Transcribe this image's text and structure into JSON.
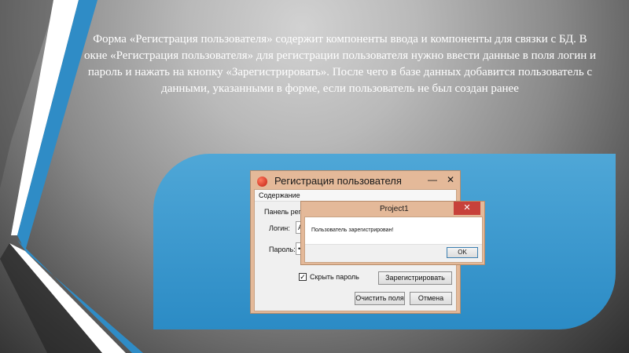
{
  "slide": {
    "caption": "Форма «Регистрация пользователя» содержит компоненты ввода и компоненты для связки с БД. В окне «Регистрация пользователя» для регистрации пользователя нужно ввести данные в поля логин и пароль и нажать на кнопку «Зарегистрировать». После чего в базе данных добавится пользователь с данными, указанными в форме, если пользователь не был создан ранее"
  },
  "reg_window": {
    "title": "Регистрация пользователя",
    "menu_item": "Содержание",
    "group_label": "Панель реги",
    "login_label": "Логин:",
    "password_label": "Пароль:",
    "login_value": "А",
    "password_value": "•",
    "show_password_label": "Скрыть пароль",
    "show_password_checked": "✓",
    "register_button": "Зарегистрировать",
    "clear_button": "Очистить поля",
    "cancel_button": "Отмена",
    "minimize_glyph": "—",
    "close_glyph": "✕"
  },
  "message_box": {
    "title": "Project1",
    "message": "Пользователь зарегистрирован!",
    "ok_button": "OK",
    "close_glyph": "✕"
  },
  "colors": {
    "panel_blue": "#3398cf",
    "window_frame": "#e4b999",
    "close_red": "#c7413a"
  }
}
